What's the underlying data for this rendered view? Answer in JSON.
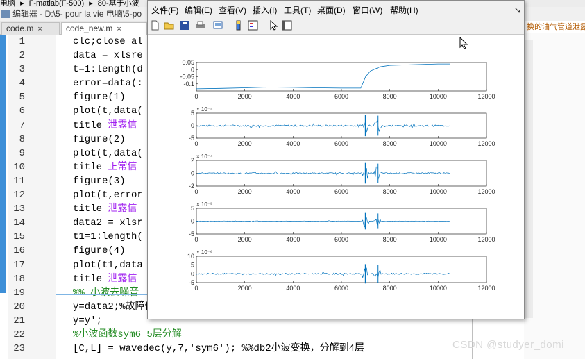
{
  "breadcrumb": [
    "电脑",
    "▸",
    "F-matlab(F-500)",
    "▸",
    "80-基于小波"
  ],
  "editor": {
    "title_prefix": "编辑器 - D:\\5- pour la vie 电脑\\5-po",
    "tabs": [
      {
        "label": "code.m"
      },
      {
        "label": "code_new.m"
      }
    ],
    "right_header": "换的油气管道泄露"
  },
  "code_lines": [
    {
      "n": "1",
      "html": "clc;close al"
    },
    {
      "n": "2",
      "html": "data = xlsre"
    },
    {
      "n": "3",
      "html": "t=1:length(d"
    },
    {
      "n": "4",
      "html": "error=data(:"
    },
    {
      "n": "5",
      "html": "figure(1)"
    },
    {
      "n": "6",
      "html": "plot(t,data("
    },
    {
      "n": "7",
      "pre": "title ",
      "str": "泄露信"
    },
    {
      "n": "8",
      "html": "figure(2)"
    },
    {
      "n": "9",
      "html": "plot(t,data("
    },
    {
      "n": "10",
      "pre": "title ",
      "str": "正常信"
    },
    {
      "n": "11",
      "html": "figure(3)"
    },
    {
      "n": "12",
      "html": "plot(t,error"
    },
    {
      "n": "13",
      "pre": "title ",
      "str": "泄露信"
    },
    {
      "n": "14",
      "html": "data2 = xlsr"
    },
    {
      "n": "15",
      "html": "t1=1:length("
    },
    {
      "n": "16",
      "html": "figure(4)"
    },
    {
      "n": "17",
      "html": "plot(t1,data"
    },
    {
      "n": "18",
      "pre": "title ",
      "str": "泄露信"
    },
    {
      "n": "19",
      "cm": "%% 小波去噪音"
    },
    {
      "n": "20",
      "html": "y=data2;%故障信号;"
    },
    {
      "n": "21",
      "html": "y=y';"
    },
    {
      "n": "22",
      "cm": "%小波函数sym6 5层分解"
    },
    {
      "n": "23",
      "html": "[C,L] = wavedec(y,7,'sym6'); %%db2小波变换，分解到4层"
    }
  ],
  "figure": {
    "menu": [
      "文件(F)",
      "编辑(E)",
      "查看(V)",
      "插入(I)",
      "工具(T)",
      "桌面(D)",
      "窗口(W)",
      "帮助(H)"
    ],
    "toolbar_icons": [
      "new-file-icon",
      "open-folder-icon",
      "save-icon",
      "print-icon",
      "print-preview-icon",
      "colorbar-icon",
      "legend-icon",
      "pointer-icon",
      "property-editor-icon"
    ]
  },
  "chart_data": [
    {
      "type": "line",
      "xlim": [
        0,
        12000
      ],
      "ylim": [
        -0.15,
        0.05
      ],
      "xticks": [
        "0",
        "2000",
        "4000",
        "6000",
        "8000",
        "10000",
        "12000"
      ],
      "yticks": [
        "0.05",
        "0",
        "-0.05",
        "-0.1"
      ],
      "exponent": "",
      "x": [
        0,
        1000,
        2000,
        3000,
        4000,
        5000,
        6000,
        6800,
        7000,
        7200,
        7600,
        8000,
        9000,
        10000,
        10500
      ],
      "y": [
        -0.135,
        -0.132,
        -0.128,
        -0.123,
        -0.125,
        -0.128,
        -0.13,
        -0.13,
        -0.05,
        -0.01,
        0.02,
        0.03,
        0.035,
        0.04,
        0.04
      ]
    },
    {
      "type": "line",
      "xlim": [
        0,
        12000
      ],
      "ylim": [
        -5,
        5
      ],
      "xticks": [
        "0",
        "2000",
        "4000",
        "6000",
        "8000",
        "10000",
        "12000"
      ],
      "yticks": [
        "5",
        "0",
        "-5"
      ],
      "exponent": "× 10⁻⁴",
      "bursts": [
        {
          "x": 7000,
          "amp": 4.2
        },
        {
          "x": 7500,
          "amp": 4.0
        }
      ],
      "noise": 0.35
    },
    {
      "type": "line",
      "xlim": [
        0,
        12000
      ],
      "ylim": [
        -2,
        2
      ],
      "xticks": [
        "0",
        "2000",
        "4000",
        "6000",
        "8000",
        "10000",
        "12000"
      ],
      "yticks": [
        "2",
        "0",
        "-2"
      ],
      "exponent": "× 10⁻⁴",
      "bursts": [
        {
          "x": 7000,
          "amp": 1.6
        },
        {
          "x": 7500,
          "amp": 1.5
        }
      ],
      "noise": 0.1
    },
    {
      "type": "line",
      "xlim": [
        0,
        12000
      ],
      "ylim": [
        -5,
        5
      ],
      "xticks": [
        "0",
        "2000",
        "4000",
        "6000",
        "8000",
        "10000",
        "12000"
      ],
      "yticks": [
        "5",
        "0",
        "-5"
      ],
      "exponent": "× 10⁻⁵",
      "bursts": [
        {
          "x": 7000,
          "amp": 3.2
        },
        {
          "x": 7500,
          "amp": 3.0
        }
      ],
      "noise": 0.08
    },
    {
      "type": "line",
      "xlim": [
        0,
        12000
      ],
      "ylim": [
        -5,
        10
      ],
      "xticks": [
        "0",
        "2000",
        "4000",
        "6000",
        "8000",
        "10000",
        "12000"
      ],
      "yticks": [
        "10",
        "5",
        "0",
        "-5"
      ],
      "exponent": "× 10⁻⁶",
      "bursts": [
        {
          "x": 7000,
          "amp": 5.5
        },
        {
          "x": 7500,
          "amp": 5.0
        }
      ],
      "noise": 0.4
    }
  ],
  "watermark": "CSDN @studyer_domi"
}
